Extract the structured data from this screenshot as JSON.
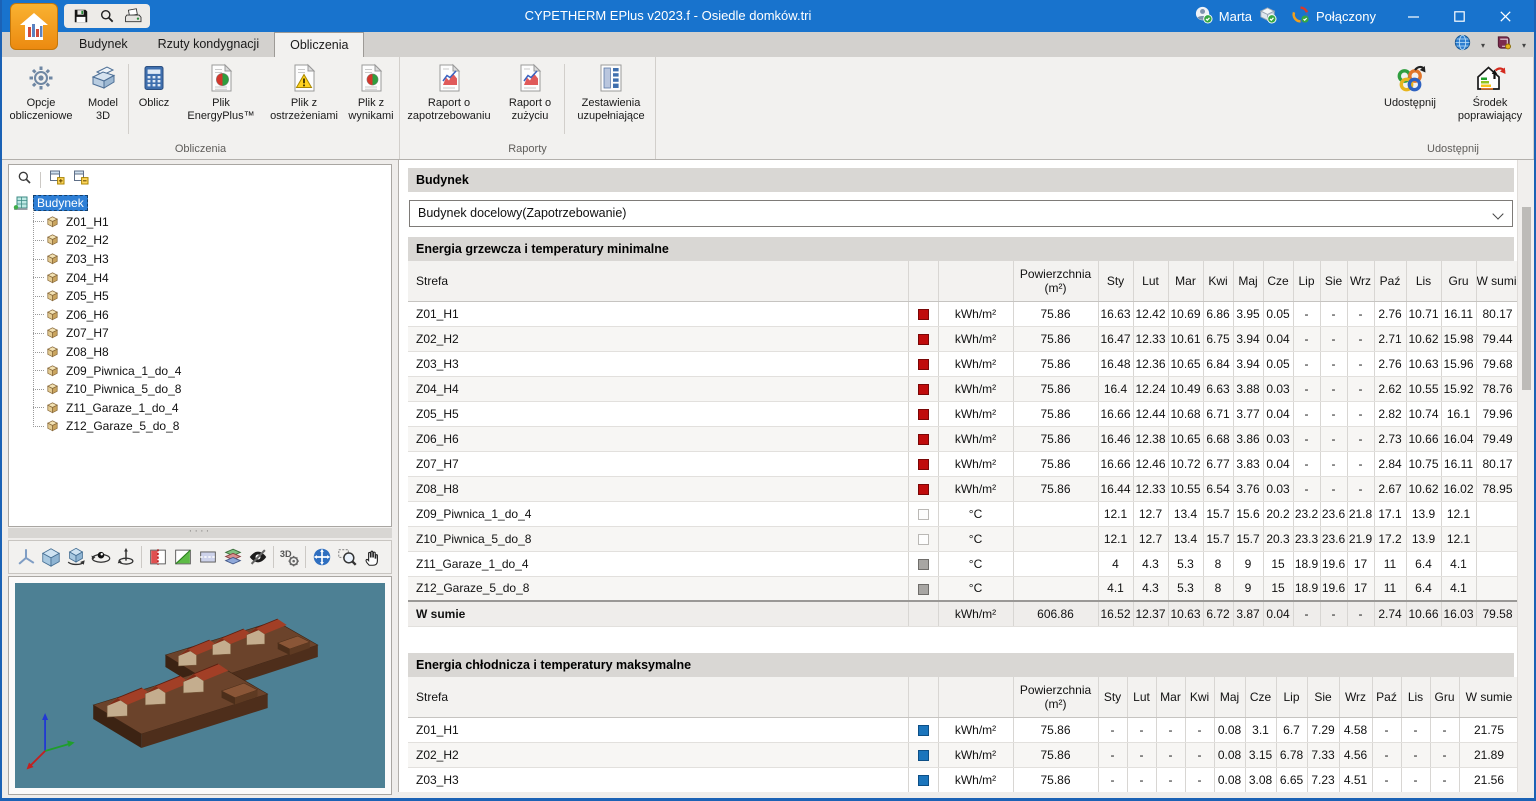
{
  "window": {
    "title": "CYPETHERM EPlus v2023.f - Osiedle domków.tri",
    "user": "Marta",
    "connection_status": "Połączony",
    "controls": [
      "minimize",
      "maximize",
      "close"
    ],
    "colors": {
      "titlebar": "#1873cd",
      "accent_blue": "#2e7fd6"
    }
  },
  "quick_access": {
    "icons": [
      "save-icon",
      "search-icon",
      "print-icon"
    ]
  },
  "tabstrip_icons": [
    "language-globe-icon",
    "help-book-icon"
  ],
  "tabs": [
    {
      "label": "Budynek",
      "active": false
    },
    {
      "label": "Rzuty kondygnacji",
      "active": false
    },
    {
      "label": "Obliczenia",
      "active": true
    }
  ],
  "ribbon": {
    "groups": [
      {
        "label": "Obliczenia",
        "buttons": [
          {
            "lines": [
              "Opcje",
              "obliczeniowe"
            ],
            "icon": "calculation-options-gear-icon"
          },
          {
            "lines": [
              "Model",
              "3D"
            ],
            "icon": "model-3d-icon"
          },
          {
            "lines": [
              "Oblicz"
            ],
            "icon": "calculate-icon"
          },
          {
            "lines": [
              "Plik",
              "EnergyPlus™"
            ],
            "icon": "energyplus-file-icon"
          },
          {
            "lines": [
              "Plik z",
              "ostrzeżeniami"
            ],
            "icon": "warnings-file-icon"
          },
          {
            "lines": [
              "Plik z",
              "wynikami"
            ],
            "icon": "results-file-icon"
          }
        ]
      },
      {
        "label": "Raporty",
        "buttons": [
          {
            "lines": [
              "Raport o",
              "zapotrzebowaniu"
            ],
            "icon": "demand-report-icon"
          },
          {
            "lines": [
              "Raport o",
              "zużyciu"
            ],
            "icon": "consumption-report-icon"
          },
          {
            "lines": [
              "Zestawienia",
              "uzupełniające"
            ],
            "icon": "supplementary-summaries-icon"
          }
        ]
      },
      {
        "label": "Udostępnij",
        "buttons": [
          {
            "lines": [
              "Udostępnij"
            ],
            "icon": "share-icon"
          },
          {
            "lines": [
              "Środek",
              "poprawiający"
            ],
            "icon": "improvement-measure-icon"
          }
        ]
      }
    ]
  },
  "tree": {
    "toolbar_icons": [
      "tree-search-icon",
      "expand-all-icon",
      "collapse-all-icon"
    ],
    "root": "Budynek",
    "items": [
      "Z01_H1",
      "Z02_H2",
      "Z03_H3",
      "Z04_H4",
      "Z05_H5",
      "Z06_H6",
      "Z07_H7",
      "Z08_H8",
      "Z09_Piwnica_1_do_4",
      "Z10_Piwnica_5_do_8",
      "Z11_Garaze_1_do_4",
      "Z12_Garaze_5_do_8"
    ]
  },
  "viewport": {
    "toolbar_icons": [
      "axes-icon",
      "isometric-cube-icon",
      "rotate-model-icon",
      "orbit-view-icon",
      "turntable-icon",
      "front-section-icon",
      "side-section-icon",
      "top-section-icon",
      "layers-icon",
      "hide-elements-icon",
      "3d-settings-icon",
      "zoom-extents-icon",
      "zoom-window-icon",
      "pan-icon"
    ]
  },
  "main": {
    "panel_title": "Budynek",
    "building_select": {
      "value": "Budynek docelowy(Zapotrzebowanie)"
    },
    "month_headers": [
      "Sty",
      "Lut",
      "Mar",
      "Kwi",
      "Maj",
      "Cze",
      "Lip",
      "Sie",
      "Wrz",
      "Paź",
      "Lis",
      "Gru"
    ],
    "col_headers": {
      "zone": "Strefa",
      "area_line1": "Powierzchnia",
      "area_line2": "(m²)",
      "total": "W sumie"
    },
    "marker_colors": {
      "heating": "#c00b0b",
      "cooling": "#1b75bc",
      "garage": "#a8a6a3",
      "basement": "#fdfdfd"
    },
    "tables": [
      {
        "title": "Energia grzewcza i temperatury minimalne",
        "rows": [
          {
            "zone": "Z01_H1",
            "marker": "red",
            "unit": "kWh/m²",
            "area": "75.86",
            "months": [
              "16.63",
              "12.42",
              "10.69",
              "6.86",
              "3.95",
              "0.05",
              "-",
              "-",
              "-",
              "2.76",
              "10.71",
              "16.11"
            ],
            "total": "80.17"
          },
          {
            "zone": "Z02_H2",
            "marker": "red",
            "unit": "kWh/m²",
            "area": "75.86",
            "months": [
              "16.47",
              "12.33",
              "10.61",
              "6.75",
              "3.94",
              "0.04",
              "-",
              "-",
              "-",
              "2.71",
              "10.62",
              "15.98"
            ],
            "total": "79.44"
          },
          {
            "zone": "Z03_H3",
            "marker": "red",
            "unit": "kWh/m²",
            "area": "75.86",
            "months": [
              "16.48",
              "12.36",
              "10.65",
              "6.84",
              "3.94",
              "0.05",
              "-",
              "-",
              "-",
              "2.76",
              "10.63",
              "15.96"
            ],
            "total": "79.68"
          },
          {
            "zone": "Z04_H4",
            "marker": "red",
            "unit": "kWh/m²",
            "area": "75.86",
            "months": [
              "16.4",
              "12.24",
              "10.49",
              "6.63",
              "3.88",
              "0.03",
              "-",
              "-",
              "-",
              "2.62",
              "10.55",
              "15.92"
            ],
            "total": "78.76"
          },
          {
            "zone": "Z05_H5",
            "marker": "red",
            "unit": "kWh/m²",
            "area": "75.86",
            "months": [
              "16.66",
              "12.44",
              "10.68",
              "6.71",
              "3.77",
              "0.04",
              "-",
              "-",
              "-",
              "2.82",
              "10.74",
              "16.1"
            ],
            "total": "79.96"
          },
          {
            "zone": "Z06_H6",
            "marker": "red",
            "unit": "kWh/m²",
            "area": "75.86",
            "months": [
              "16.46",
              "12.38",
              "10.65",
              "6.68",
              "3.86",
              "0.03",
              "-",
              "-",
              "-",
              "2.73",
              "10.66",
              "16.04"
            ],
            "total": "79.49"
          },
          {
            "zone": "Z07_H7",
            "marker": "red",
            "unit": "kWh/m²",
            "area": "75.86",
            "months": [
              "16.66",
              "12.46",
              "10.72",
              "6.77",
              "3.83",
              "0.04",
              "-",
              "-",
              "-",
              "2.84",
              "10.75",
              "16.11"
            ],
            "total": "80.17"
          },
          {
            "zone": "Z08_H8",
            "marker": "red",
            "unit": "kWh/m²",
            "area": "75.86",
            "months": [
              "16.44",
              "12.33",
              "10.55",
              "6.54",
              "3.76",
              "0.03",
              "-",
              "-",
              "-",
              "2.67",
              "10.62",
              "16.02"
            ],
            "total": "78.95"
          },
          {
            "zone": "Z09_Piwnica_1_do_4",
            "marker": "white",
            "unit": "°C",
            "area": "",
            "months": [
              "12.1",
              "12.7",
              "13.4",
              "15.7",
              "15.6",
              "20.2",
              "23.2",
              "23.6",
              "21.8",
              "17.1",
              "13.9",
              "12.1"
            ],
            "total": ""
          },
          {
            "zone": "Z10_Piwnica_5_do_8",
            "marker": "white",
            "unit": "°C",
            "area": "",
            "months": [
              "12.1",
              "12.7",
              "13.4",
              "15.7",
              "15.7",
              "20.3",
              "23.3",
              "23.6",
              "21.9",
              "17.2",
              "13.9",
              "12.1"
            ],
            "total": ""
          },
          {
            "zone": "Z11_Garaze_1_do_4",
            "marker": "gray",
            "unit": "°C",
            "area": "",
            "months": [
              "4",
              "4.3",
              "5.3",
              "8",
              "9",
              "15",
              "18.9",
              "19.6",
              "17",
              "11",
              "6.4",
              "4.1"
            ],
            "total": ""
          },
          {
            "zone": "Z12_Garaze_5_do_8",
            "marker": "gray",
            "unit": "°C",
            "area": "",
            "months": [
              "4.1",
              "4.3",
              "5.3",
              "8",
              "9",
              "15",
              "18.9",
              "19.6",
              "17",
              "11",
              "6.4",
              "4.1"
            ],
            "total": ""
          }
        ],
        "sum_row": {
          "zone": "W sumie",
          "marker": "none",
          "unit": "kWh/m²",
          "area": "606.86",
          "months": [
            "16.52",
            "12.37",
            "10.63",
            "6.72",
            "3.87",
            "0.04",
            "-",
            "-",
            "-",
            "2.74",
            "10.66",
            "16.03"
          ],
          "total": "79.58"
        }
      },
      {
        "title": "Energia chłodnicza i temperatury maksymalne",
        "rows": [
          {
            "zone": "Z01_H1",
            "marker": "blue",
            "unit": "kWh/m²",
            "area": "75.86",
            "months": [
              "-",
              "-",
              "-",
              "-",
              "0.08",
              "3.1",
              "6.7",
              "7.29",
              "4.58",
              "-",
              "-",
              "-"
            ],
            "total": "21.75"
          },
          {
            "zone": "Z02_H2",
            "marker": "blue",
            "unit": "kWh/m²",
            "area": "75.86",
            "months": [
              "-",
              "-",
              "-",
              "-",
              "0.08",
              "3.15",
              "6.78",
              "7.33",
              "4.56",
              "-",
              "-",
              "-"
            ],
            "total": "21.89"
          },
          {
            "zone": "Z03_H3",
            "marker": "blue",
            "unit": "kWh/m²",
            "area": "75.86",
            "months": [
              "-",
              "-",
              "-",
              "-",
              "0.08",
              "3.08",
              "6.65",
              "7.23",
              "4.51",
              "-",
              "-",
              "-"
            ],
            "total": "21.56"
          }
        ]
      }
    ]
  }
}
